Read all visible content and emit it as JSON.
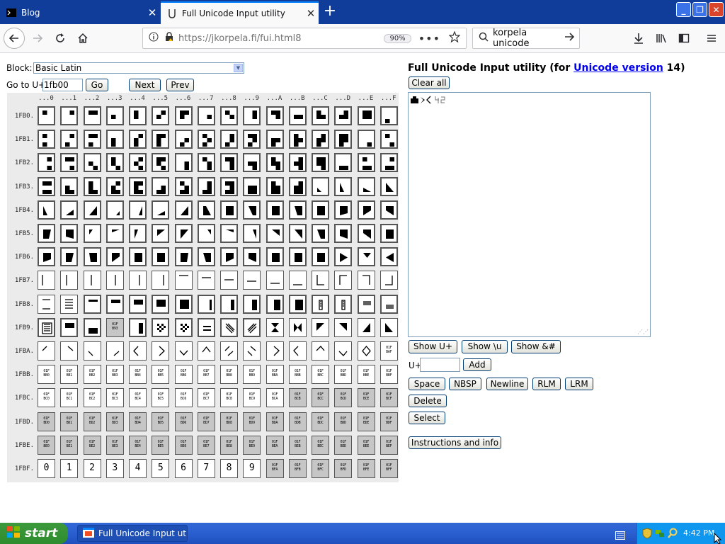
{
  "browser": {
    "tabs": [
      {
        "label": "Blog",
        "active": false
      },
      {
        "label": "Full Unicode Input utility",
        "active": true
      }
    ],
    "url": "https://jkorpela.fi/fui.html8",
    "zoom": "90%",
    "search_text": "korpela unicode"
  },
  "controls": {
    "block_label": "Block:",
    "block_value": "Basic Latin",
    "goto_label": "Go to U+",
    "goto_value": "1fb00",
    "go_button": "Go",
    "next_button": "Next",
    "prev_button": "Prev"
  },
  "grid": {
    "column_headers": [
      "...0",
      "...1",
      "...2",
      "...3",
      "...4",
      "...5",
      "...6",
      "...7",
      "...8",
      "...9",
      "...A",
      "...B",
      "...C",
      "...D",
      "...E",
      "...F"
    ],
    "row_headers": [
      "1FB0.",
      "1FB1.",
      "1FB2.",
      "1FB3.",
      "1FB4.",
      "1FB5.",
      "1FB6.",
      "1FB7.",
      "1FB8.",
      "1FB9.",
      "1FBA.",
      "1FBB.",
      "1FBC.",
      "1FBD.",
      "1FBE.",
      "1FBF."
    ]
  },
  "panel": {
    "title_prefix": "Full Unicode Input utility (for ",
    "title_link": "Unicode version",
    "title_suffix": " 14)",
    "clear_all": "Clear all",
    "textarea_content": "🭶🮑〈🯴🯲",
    "show_uplus": "Show U+",
    "show_backslash_u": "Show \\u",
    "show_amp": "Show &#",
    "uplus_label": "U+",
    "uplus_value": "",
    "add": "Add",
    "space": "Space",
    "nbsp": "NBSP",
    "newline": "Newline",
    "rlm": "RLM",
    "lrm": "LRM",
    "delete": "Delete",
    "select": "Select",
    "instructions": "Instructions and info"
  },
  "taskbar": {
    "start": "start",
    "task_item": "Full Unicode Input util...",
    "clock": "4:42 PM"
  }
}
